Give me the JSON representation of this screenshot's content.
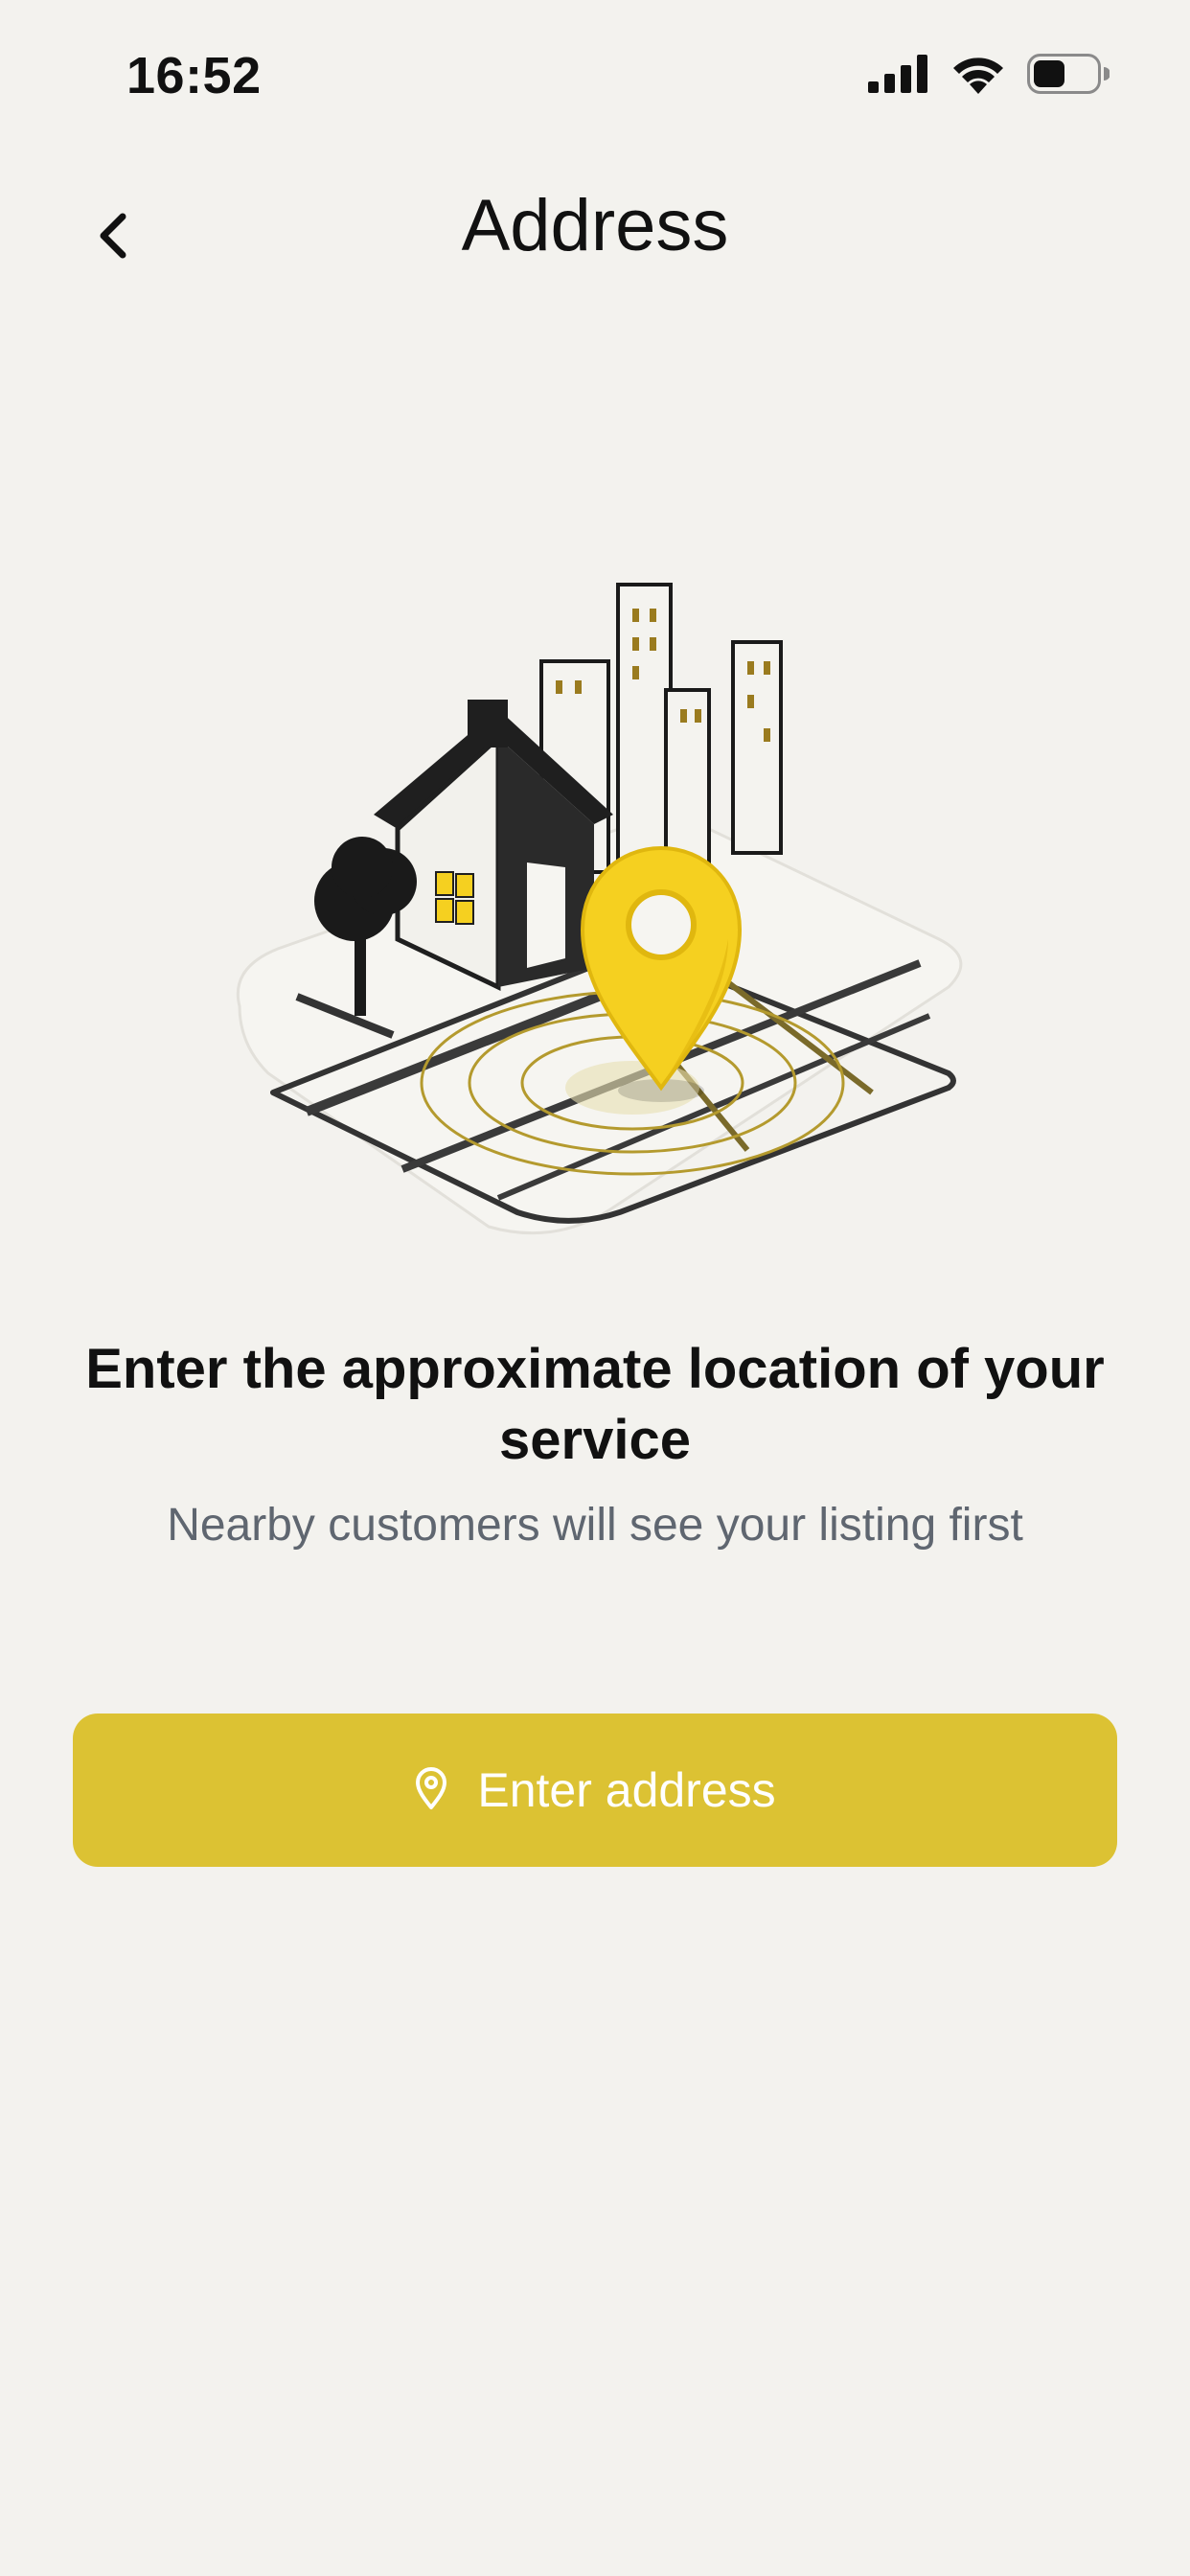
{
  "status_bar": {
    "time": "16:52",
    "icons": [
      "cellular-signal-icon",
      "wifi-icon",
      "battery-icon"
    ]
  },
  "header": {
    "title": "Address",
    "back_icon": "chevron-left-icon"
  },
  "illustration": {
    "description_icon": "house-with-location-pin-illustration"
  },
  "content": {
    "headline": "Enter the approximate location of your service",
    "subline": "Nearby customers will see your listing first"
  },
  "action": {
    "label": "Enter address",
    "icon": "location-pin-icon"
  },
  "colors": {
    "background": "#f3f2ee",
    "accent": "#dcc233",
    "pin": "#f5d020",
    "subtext": "#5f6670"
  }
}
